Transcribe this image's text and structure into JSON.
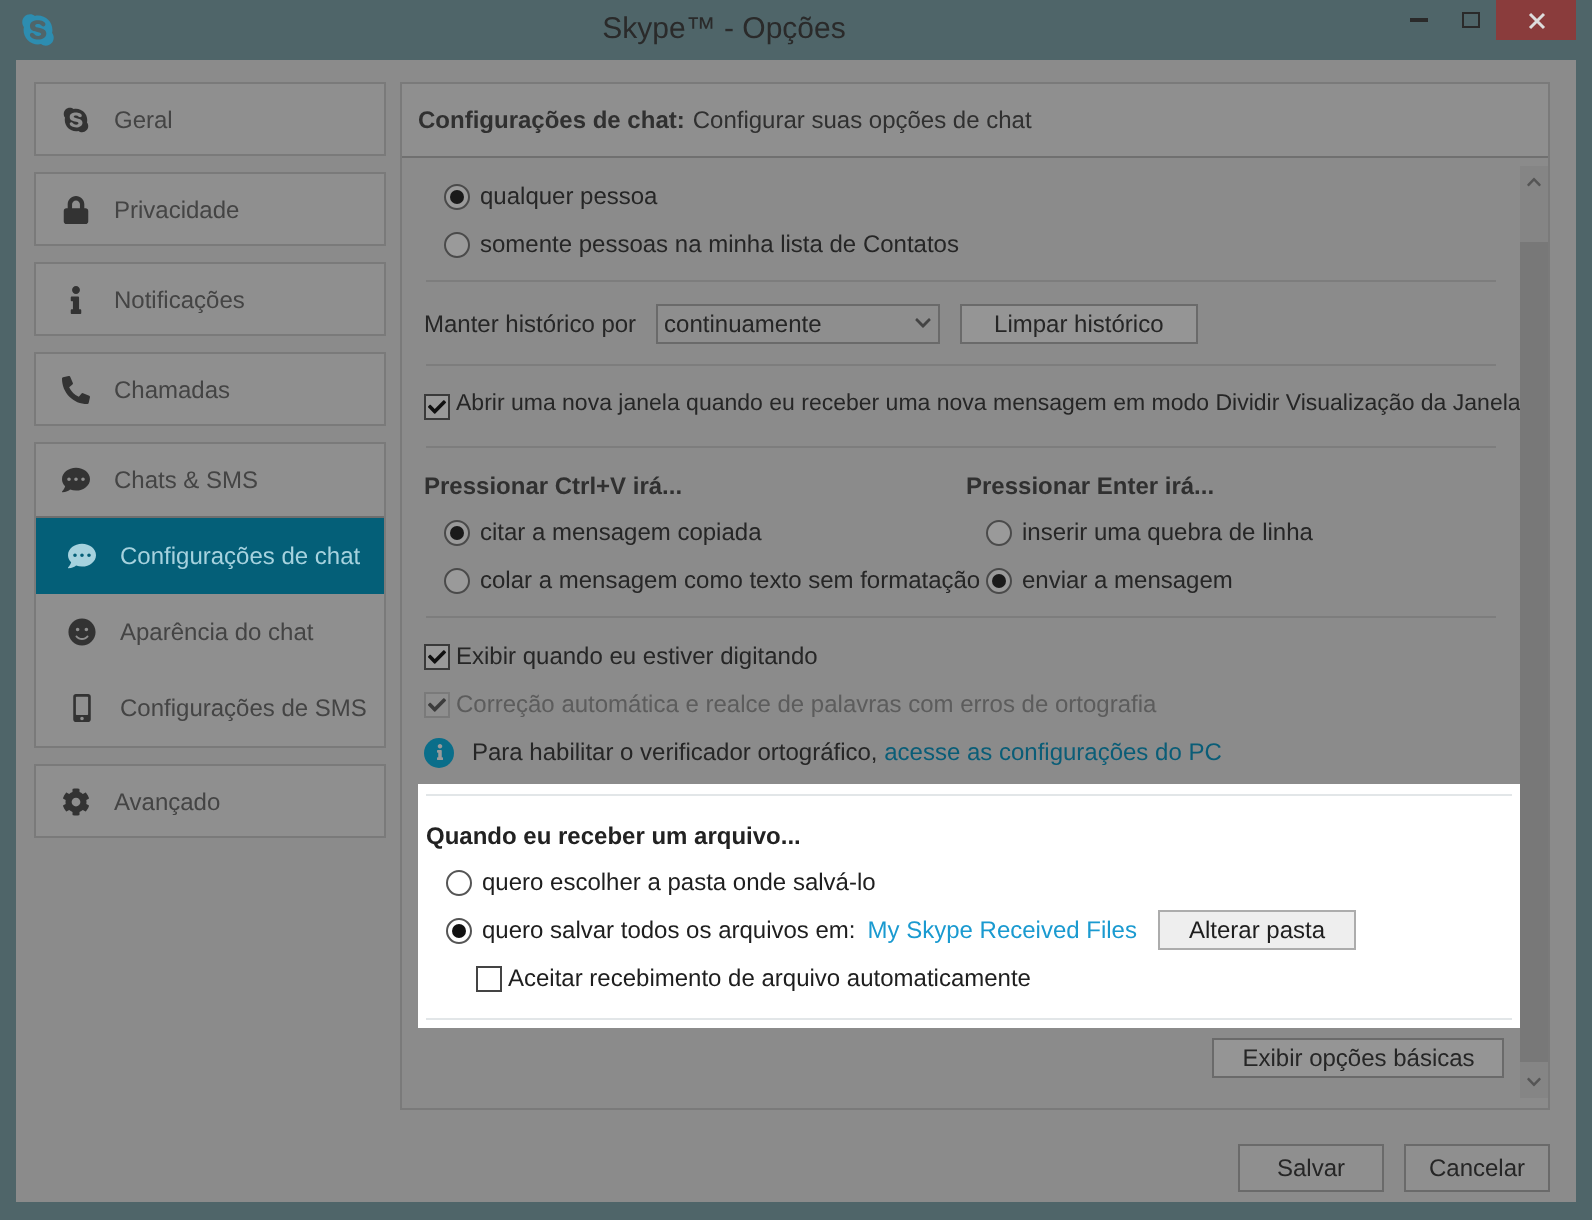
{
  "window": {
    "title": "Skype™ - Opções"
  },
  "sidebar": {
    "items": [
      {
        "label": "Geral",
        "selected": false
      },
      {
        "label": "Privacidade",
        "selected": false
      },
      {
        "label": "Notificações",
        "selected": false
      },
      {
        "label": "Chamadas",
        "selected": false
      },
      {
        "label": "Chats & SMS",
        "selected": false,
        "children": [
          {
            "label": "Configurações de chat",
            "selected": true
          },
          {
            "label": "Aparência do chat",
            "selected": false
          },
          {
            "label": "Configurações de SMS",
            "selected": false
          }
        ]
      },
      {
        "label": "Avançado",
        "selected": false
      }
    ]
  },
  "header": {
    "title": "Configurações de chat:",
    "subtitle": "Configurar suas opções de chat"
  },
  "contact_options": [
    {
      "label": "qualquer pessoa",
      "selected": true
    },
    {
      "label": "somente pessoas na minha lista de Contatos",
      "selected": false
    }
  ],
  "history": {
    "label": "Manter histórico por",
    "value": "continuamente",
    "button": "Limpar histórico"
  },
  "open_window": {
    "label": "Abrir uma nova janela quando eu receber uma nova mensagem em modo Dividir Visualização da Janela",
    "checked": true
  },
  "ctrl_v": {
    "title": "Pressionar Ctrl+V irá...",
    "options": [
      {
        "label": "citar a mensagem copiada",
        "selected": true
      },
      {
        "label": "colar a mensagem como texto sem formatação",
        "selected": false
      }
    ]
  },
  "enter": {
    "title": "Pressionar Enter irá...",
    "options": [
      {
        "label": "inserir uma quebra de linha",
        "selected": false
      },
      {
        "label": "enviar a mensagem",
        "selected": true
      }
    ]
  },
  "typing": {
    "label": "Exibir quando eu estiver digitando",
    "checked": true,
    "disabled": false
  },
  "autocorrect": {
    "label": "Correção automática e realce de palavras com erros de ortografia",
    "checked": true,
    "disabled": true
  },
  "info": {
    "text": "Para habilitar o verificador ortográfico,",
    "link": "acesse as configurações do PC"
  },
  "file_section": {
    "title": "Quando eu receber um arquivo...",
    "options": [
      {
        "label": "quero escolher a pasta onde salvá-lo",
        "selected": false
      },
      {
        "label": "quero salvar todos os arquivos em:",
        "selected": true,
        "link": "My Skype Received Files",
        "button": "Alterar pasta"
      }
    ],
    "auto_accept": {
      "label": "Aceitar recebimento de arquivo automaticamente",
      "checked": false
    }
  },
  "basic_options_button": "Exibir opções básicas",
  "buttons": [
    "Salvar",
    "Cancelar"
  ]
}
